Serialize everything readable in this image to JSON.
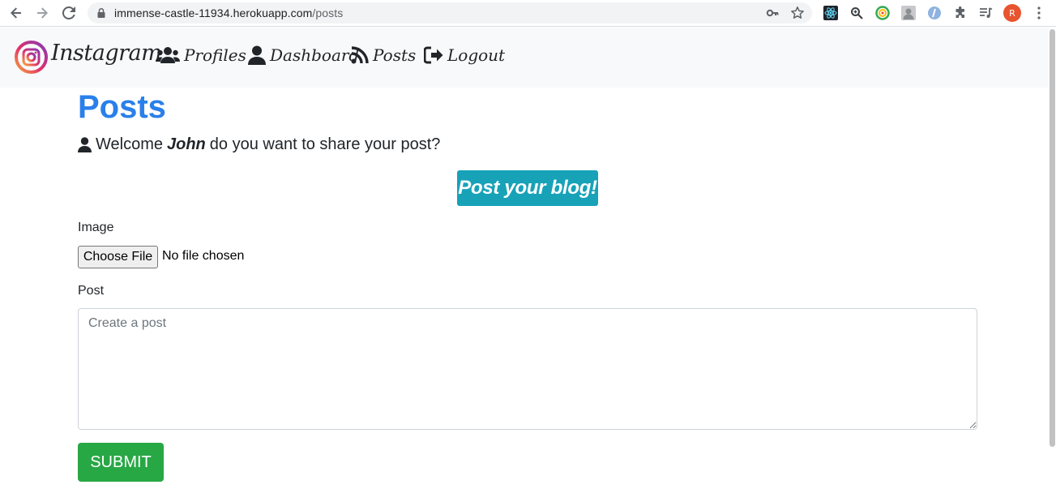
{
  "browser": {
    "url_host": "immense-castle-11934.herokuapp.com",
    "url_path": "/posts",
    "profile_initial": "R"
  },
  "navbar": {
    "brand": "Instagram",
    "links": [
      {
        "label": "Profiles",
        "icon": "users-icon"
      },
      {
        "label": "Dashboard",
        "icon": "user-icon"
      },
      {
        "label": "Posts",
        "icon": "rss-icon"
      },
      {
        "label": "Logout",
        "icon": "sign-out-icon"
      }
    ]
  },
  "main": {
    "title": "Posts",
    "welcome_prefix": "Welcome",
    "welcome_name": "John",
    "welcome_suffix": "do you want to share your post?",
    "cta_label": "Post your blog!"
  },
  "form": {
    "image_label": "Image",
    "file_button": "Choose File",
    "file_status": "No file chosen",
    "post_label": "Post",
    "post_placeholder": "Create a post",
    "submit_label": "SUBMIT"
  },
  "colors": {
    "title": "#2a7fea",
    "cta": "#17a2b8",
    "submit": "#28a745",
    "navbar_bg": "#f8f9fa"
  }
}
